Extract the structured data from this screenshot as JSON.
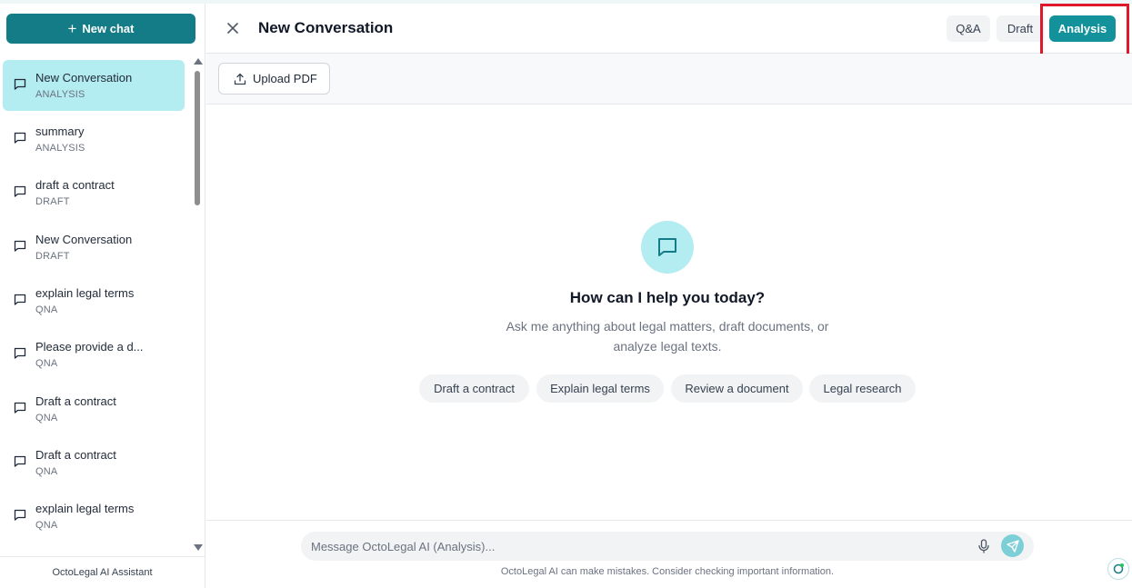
{
  "sidebar": {
    "new_chat_label": "New chat",
    "conversations": [
      {
        "title": "New Conversation",
        "kind": "ANALYSIS",
        "active": true
      },
      {
        "title": "summary",
        "kind": "ANALYSIS"
      },
      {
        "title": "draft a contract",
        "kind": "DRAFT"
      },
      {
        "title": "New Conversation",
        "kind": "DRAFT"
      },
      {
        "title": "explain legal terms",
        "kind": "QNA"
      },
      {
        "title": "Please provide a d...",
        "kind": "QNA"
      },
      {
        "title": "Draft a contract",
        "kind": "QNA"
      },
      {
        "title": "Draft a contract",
        "kind": "QNA"
      },
      {
        "title": "explain legal terms",
        "kind": "QNA"
      }
    ],
    "footer": "OctoLegal AI Assistant"
  },
  "header": {
    "title": "New Conversation",
    "modes": {
      "qa": "Q&A",
      "draft": "Draft",
      "analysis": "Analysis"
    },
    "active_mode": "Analysis"
  },
  "toolbar": {
    "upload_label": "Upload PDF"
  },
  "empty_state": {
    "title": "How can I help you today?",
    "subtitle_line1": "Ask me anything about legal matters, draft documents, or",
    "subtitle_line2": "analyze legal texts.",
    "suggestions": [
      "Draft a contract",
      "Explain legal terms",
      "Review a document",
      "Legal research"
    ]
  },
  "composer": {
    "placeholder": "Message OctoLegal AI (Analysis)...",
    "disclaimer": "OctoLegal AI can make mistakes. Consider checking important information."
  },
  "colors": {
    "brand": "#137c86",
    "active_mode": "#13929c",
    "active_item_bg": "#b3ecf1",
    "highlight": "#e0182b"
  }
}
